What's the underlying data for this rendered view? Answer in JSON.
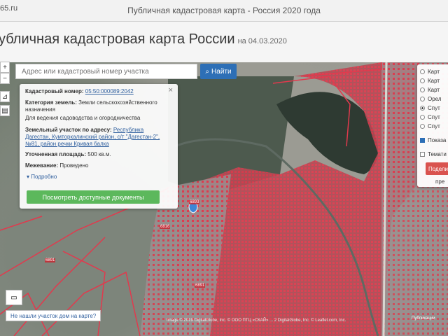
{
  "topbar": {
    "site_fragment": "65.ru",
    "window_title": "Публичная кадастровая карта - Россия 2020 года"
  },
  "header": {
    "title": "убличная кадастровая карта России",
    "date": "на 04.03.2020"
  },
  "search": {
    "placeholder": "Адрес или кадастровый номер участка",
    "button_label": "Найти"
  },
  "tools": {
    "zoom_in": "+",
    "zoom_out": "−"
  },
  "info_panel": {
    "close": "×",
    "cadastral_number_label": "Кадастровый номер:",
    "cadastral_number": "05:50:000089:2042",
    "category_label": "Категория земель:",
    "category_value": "Земли сельскохозяйственного назначения",
    "usage": "Для ведения садоводства и огородничества",
    "address_label": "Земельный участок по адресу:",
    "address_value": "Республика Дагестан, Кумторкалинский район, с/т \"Дагестан-2\", №81, район речки Кривая балка",
    "area_label": "Уточненная площадь:",
    "area_value": "500 кв.м.",
    "boundary_label": "Межевание:",
    "boundary_value": "Проведено",
    "more_link": "Подробно",
    "documents_button": "Посмотреть доступные документы"
  },
  "layers_panel": {
    "items": [
      {
        "label": "Карт",
        "selected": false
      },
      {
        "label": "Карт",
        "selected": false
      },
      {
        "label": "Карт",
        "selected": false
      },
      {
        "label": "Opел",
        "selected": false
      },
      {
        "label": "Спут",
        "selected": true
      },
      {
        "label": "Спут",
        "selected": false
      },
      {
        "label": "Спут",
        "selected": false
      }
    ],
    "checkboxes": [
      {
        "label": "Показа границ",
        "checked": true
      },
      {
        "label": "Темати",
        "checked": false
      }
    ],
    "action_button": "Подели",
    "bottom_text": "пре"
  },
  "map": {
    "not_found_button": "Не нашли участок дом на карте?",
    "copyright": "Image © 2019 DigitalGlobe, Inc. © ООО ПТЦ «СКАЙ» ... 2 DigitalGlobe, Inc. © Leaflet.com, Inc.",
    "brand_link": "Публикации",
    "parcel_labels": [
      "6893",
      "6891",
      "6816",
      "6891"
    ]
  },
  "colors": {
    "parcel_red": "#e2394d",
    "accent_blue": "#2d6fb6",
    "green_button": "#5cb85c",
    "red_button": "#d9534f"
  }
}
